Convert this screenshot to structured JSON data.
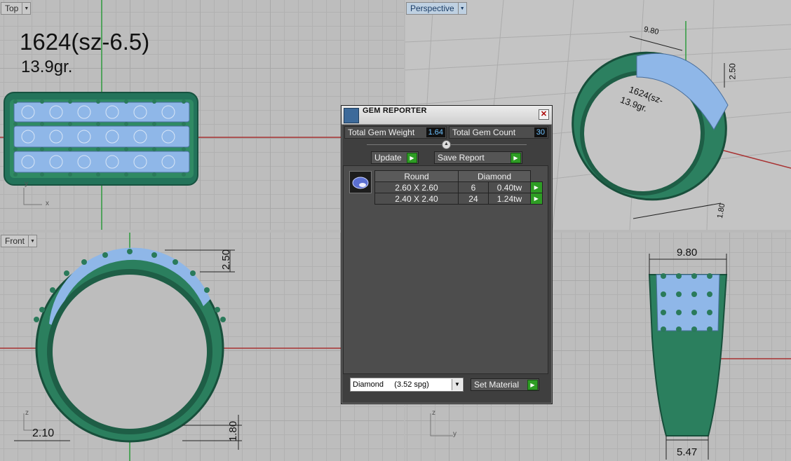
{
  "viewports": {
    "top": {
      "label": "Top",
      "title_line1": "1624(sz-6.5)",
      "title_line2": "13.9gr.",
      "axis_x": "x",
      "axis_y": "y"
    },
    "perspective": {
      "label": "Perspective",
      "dim_width": "9.80",
      "dim_height": "2.50",
      "dim_band": "1.80",
      "engraving_1": "1624(sz-",
      "engraving_2": "13.9gr."
    },
    "front": {
      "label": "Front",
      "dim_height": "2.50",
      "dim_band": "1.80",
      "dim_side": "2.10",
      "axis_z": "z"
    },
    "right": {
      "dim_top": "9.80",
      "dim_bottom": "5.47",
      "axis_z": "z",
      "axis_y": "y"
    }
  },
  "gem_reporter": {
    "title": "GEM REPORTER",
    "close_label": "✕",
    "total_weight_label": "Total Gem Weight",
    "total_weight_value": "1.64",
    "total_count_label": "Total Gem Count",
    "total_count_value": "30",
    "update_label": "Update",
    "save_report_label": "Save Report",
    "table": {
      "headers": [
        "Round",
        "Diamond"
      ],
      "rows": [
        {
          "size": "2.60 X 2.60",
          "count": "6",
          "weight": "0.40tw"
        },
        {
          "size": "2.40 X 2.40",
          "count": "24",
          "weight": "1.24tw"
        }
      ]
    },
    "material_select_value": "Diamond     (3.52 spg)",
    "set_material_label": "Set Material"
  },
  "colors": {
    "ring_green": "#2f8a63",
    "gem_blue": "#8fb7e8",
    "panel_bg": "#3f3f3f",
    "value_blue": "#6ec2ff",
    "button_green": "#2e9d24"
  }
}
